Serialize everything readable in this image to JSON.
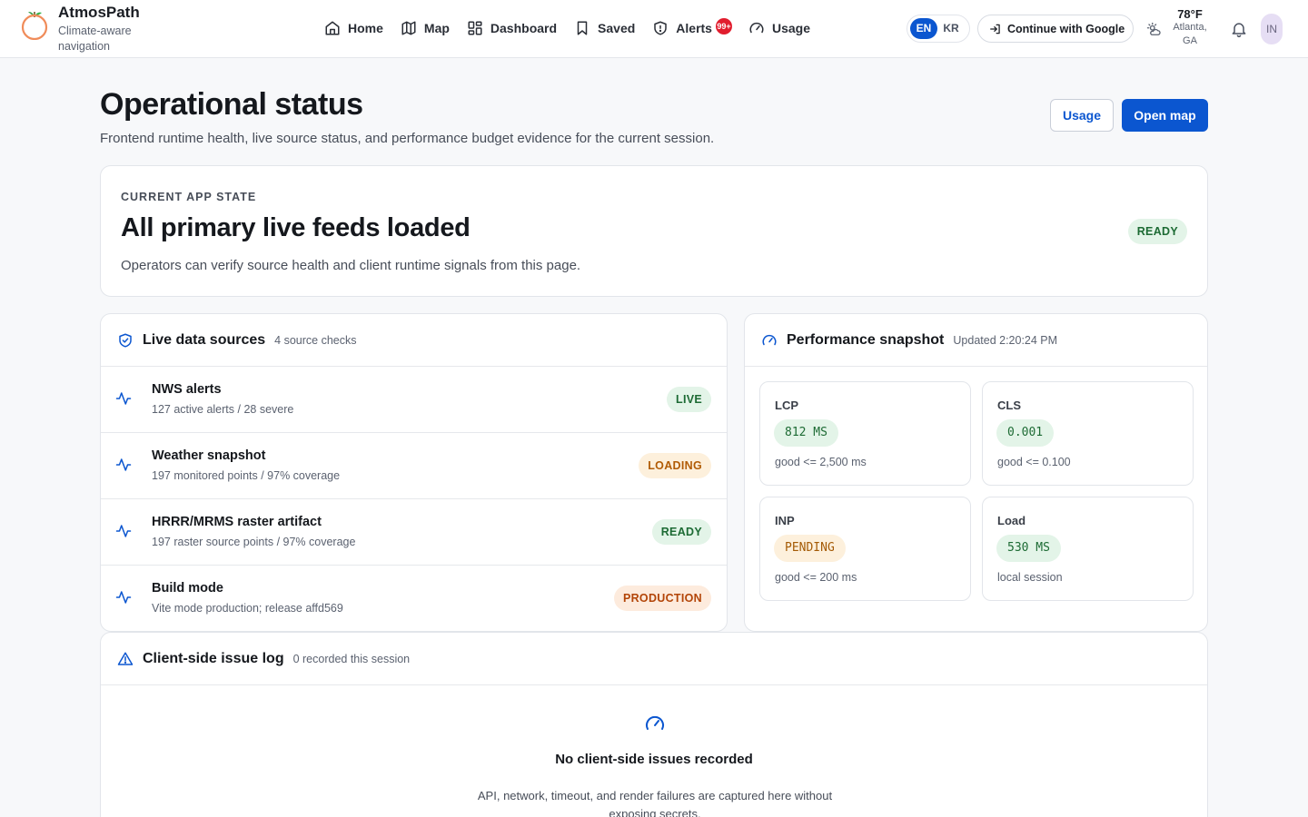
{
  "brand": {
    "title": "AtmosPath",
    "subtitle": "Climate-aware navigation"
  },
  "nav": {
    "home": "Home",
    "map": "Map",
    "dashboard": "Dashboard",
    "saved": "Saved",
    "alerts": "Alerts",
    "alerts_badge": "99+",
    "usage": "Usage"
  },
  "lang": {
    "en": "EN",
    "kr": "KR",
    "active": "EN"
  },
  "auth": {
    "google_label": "Continue with Google"
  },
  "weather": {
    "temp": "78°F",
    "location": "Atlanta, GA",
    "icon": "partly-sunny-icon"
  },
  "user": {
    "initials": "IN"
  },
  "page": {
    "title": "Operational status",
    "subtitle": "Frontend runtime health, live source status, and performance budget evidence for the current session.",
    "usage_button": "Usage",
    "open_map_button": "Open map"
  },
  "state": {
    "label": "CURRENT APP STATE",
    "title": "All primary live feeds loaded",
    "description": "Operators can verify source health and client runtime signals from this page.",
    "badge": "READY"
  },
  "sources": {
    "title": "Live data sources",
    "meta": "4 source checks",
    "items": [
      {
        "name": "NWS alerts",
        "detail": "127 active alerts / 28 severe",
        "status": "LIVE",
        "tone": "green"
      },
      {
        "name": "Weather snapshot",
        "detail": "197 monitored points / 97% coverage",
        "status": "LOADING",
        "tone": "amber"
      },
      {
        "name": "HRRR/MRMS raster artifact",
        "detail": "197 raster source points / 97% coverage",
        "status": "READY",
        "tone": "green"
      },
      {
        "name": "Build mode",
        "detail": "Vite mode production; release affd569",
        "status": "PRODUCTION",
        "tone": "peach"
      }
    ]
  },
  "performance": {
    "title": "Performance snapshot",
    "meta": "Updated 2:20:24 PM",
    "metrics": [
      {
        "label": "LCP",
        "value": "812 MS",
        "note": "good <= 2,500 ms",
        "tone": "green"
      },
      {
        "label": "CLS",
        "value": "0.001",
        "note": "good <= 0.100",
        "tone": "green"
      },
      {
        "label": "INP",
        "value": "PENDING",
        "note": "good <= 200 ms",
        "tone": "amber"
      },
      {
        "label": "Load",
        "value": "530 MS",
        "note": "local session",
        "tone": "green"
      }
    ]
  },
  "issues": {
    "title": "Client-side issue log",
    "meta": "0 recorded this session",
    "empty_title": "No client-side issues recorded",
    "empty_desc": "API, network, timeout, and render failures are captured here without exposing secrets."
  },
  "colors": {
    "accent": "#0b56d0",
    "ready": "#1d6b34",
    "loading": "#b15c06",
    "badge": "#e11d2e"
  }
}
